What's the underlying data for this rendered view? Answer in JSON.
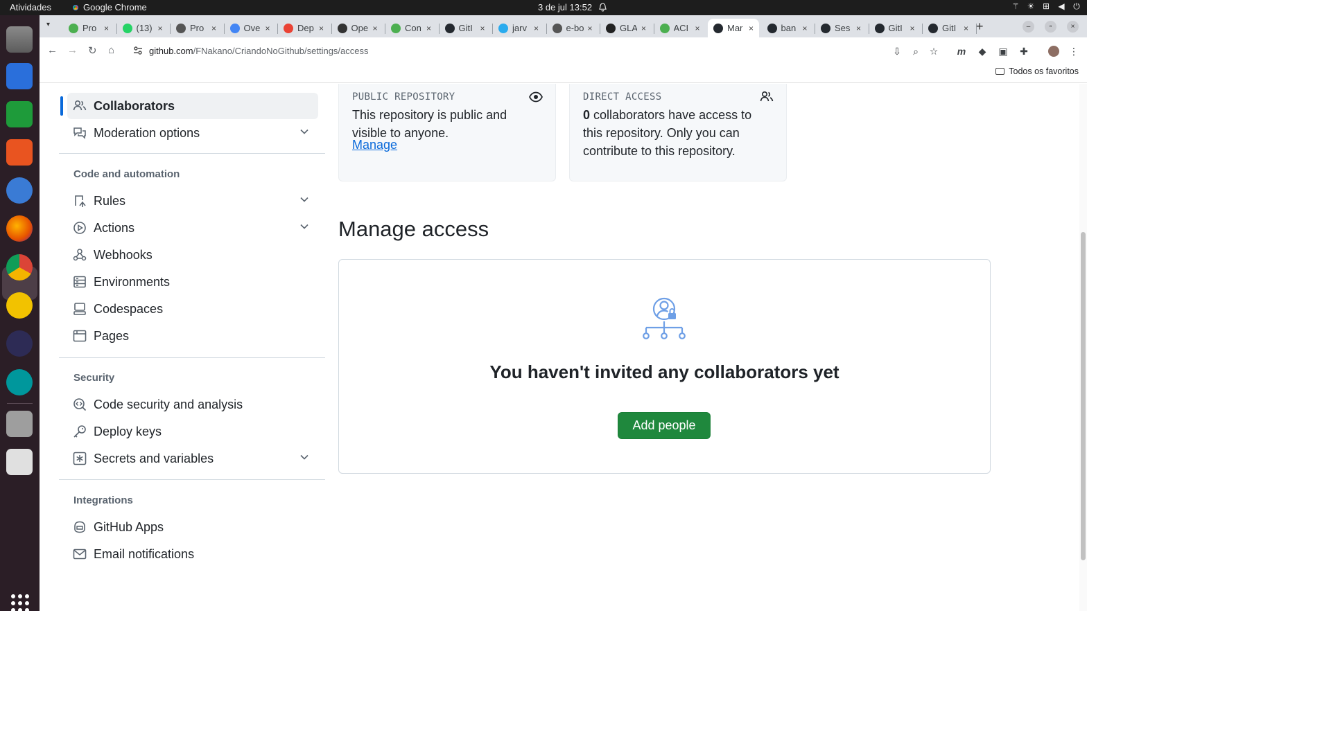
{
  "system": {
    "activities": "Atividades",
    "app_name": "Google Chrome",
    "clock": "3 de jul  13:52"
  },
  "browser": {
    "tabs": [
      {
        "title": "Pro",
        "color": "#4caf50"
      },
      {
        "title": "(13)",
        "color": "#25d366"
      },
      {
        "title": "Pro",
        "color": "#555555"
      },
      {
        "title": "Ove",
        "color": "#4285f4"
      },
      {
        "title": "Dep",
        "color": "#ea4335"
      },
      {
        "title": "Ope",
        "color": "#333333"
      },
      {
        "title": "Con",
        "color": "#4caf50"
      },
      {
        "title": "GitI",
        "color": "#24292f"
      },
      {
        "title": "jarv",
        "color": "#2aabee"
      },
      {
        "title": "e-bo",
        "color": "#555555"
      },
      {
        "title": "GLA",
        "color": "#222222"
      },
      {
        "title": "ACI",
        "color": "#4caf50"
      },
      {
        "title": "Mar",
        "color": "#24292f"
      },
      {
        "title": "ban",
        "color": "#24292f"
      },
      {
        "title": "Ses",
        "color": "#24292f"
      },
      {
        "title": "GitI",
        "color": "#24292f"
      },
      {
        "title": "GitI",
        "color": "#24292f"
      }
    ],
    "url_host": "github.com",
    "url_path": "/FNakano/CriandoNoGithub/settings/access",
    "bookmarks_label": "Todos os favoritos"
  },
  "sidebar": {
    "items_top": [
      {
        "label": "Collaborators",
        "icon": "people-icon"
      },
      {
        "label": "Moderation options",
        "icon": "comment-discussion-icon"
      }
    ],
    "section_code": "Code and automation",
    "items_code": [
      {
        "label": "Rules",
        "icon": "repo-push-icon"
      },
      {
        "label": "Actions",
        "icon": "play-icon"
      },
      {
        "label": "Webhooks",
        "icon": "webhook-icon"
      },
      {
        "label": "Environments",
        "icon": "server-icon"
      },
      {
        "label": "Codespaces",
        "icon": "codespaces-icon"
      },
      {
        "label": "Pages",
        "icon": "browser-icon"
      }
    ],
    "section_security": "Security",
    "items_security": [
      {
        "label": "Code security and analysis",
        "icon": "codescan-icon"
      },
      {
        "label": "Deploy keys",
        "icon": "key-icon"
      },
      {
        "label": "Secrets and variables",
        "icon": "key-asterisk-icon"
      }
    ],
    "section_integrations": "Integrations",
    "items_integrations": [
      {
        "label": "GitHub Apps",
        "icon": "copilot-icon"
      },
      {
        "label": "Email notifications",
        "icon": "mail-icon"
      }
    ]
  },
  "cards": {
    "public": {
      "label": "PUBLIC REPOSITORY",
      "line1": "This repository is public and",
      "line2": "visible to anyone.",
      "link": "Manage"
    },
    "direct": {
      "label": "DIRECT ACCESS",
      "count": "0",
      "line1": " collaborators have access to",
      "line2": "this repository. Only you can",
      "line3": "contribute to this repository."
    }
  },
  "manage": {
    "heading": "Manage access",
    "empty_title": "You haven't invited any collaborators yet",
    "add_button": "Add people"
  },
  "colors": {
    "accent": "#0969da",
    "primary_button": "#1f883d"
  }
}
